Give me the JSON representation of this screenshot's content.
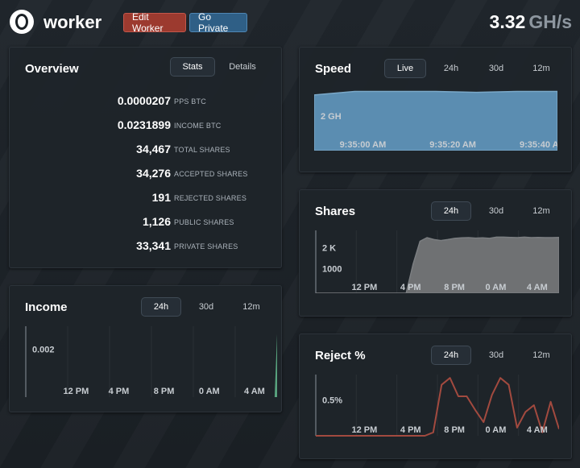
{
  "header": {
    "worker_name": "worker",
    "edit_label": "Edit Worker",
    "private_label": "Go Private",
    "hashrate_value": "3.32",
    "hashrate_unit": "GH/s"
  },
  "overview": {
    "title": "Overview",
    "tabs": [
      "Stats",
      "Details"
    ],
    "active_tab": "Stats",
    "rows": [
      {
        "value": "0.0000207",
        "label": "PPS BTC"
      },
      {
        "value": "0.0231899",
        "label": "INCOME BTC"
      },
      {
        "value": "34,467",
        "label": "TOTAL SHARES"
      },
      {
        "value": "34,276",
        "label": "ACCEPTED SHARES"
      },
      {
        "value": "191",
        "label": "REJECTED SHARES"
      },
      {
        "value": "1,126",
        "label": "PUBLIC SHARES"
      },
      {
        "value": "33,341",
        "label": "PRIVATE SHARES"
      }
    ]
  },
  "income": {
    "title": "Income",
    "tabs": [
      "24h",
      "30d",
      "12m"
    ],
    "active_tab": "24h"
  },
  "speed": {
    "title": "Speed",
    "tabs": [
      "Live",
      "24h",
      "30d",
      "12m"
    ],
    "active_tab": "Live"
  },
  "shares": {
    "title": "Shares",
    "tabs": [
      "24h",
      "30d",
      "12m"
    ],
    "active_tab": "24h"
  },
  "reject": {
    "title": "Reject %",
    "tabs": [
      "24h",
      "30d",
      "12m"
    ],
    "active_tab": "24h"
  },
  "colors": {
    "speed_fill": "#5b8db1",
    "shares_fill": "#6f7173",
    "income_fill": "#58a37e",
    "reject_line": "#a24a3f",
    "edit_button": "#9c3a2f",
    "private_button": "#2f5f86"
  },
  "chart_data": [
    {
      "id": "speed",
      "type": "area",
      "x": [
        "9:35:00 AM",
        "9:35:20 AM",
        "9:35:40 AM"
      ],
      "y_ticks": [
        "2 GH"
      ],
      "series": [
        {
          "values": [
            3.1,
            3.3,
            3.3,
            3.3,
            3.25,
            3.3,
            3.3
          ]
        }
      ],
      "ylim": [
        0,
        3.5
      ]
    },
    {
      "id": "shares",
      "type": "area",
      "x": [
        "12 PM",
        "4 PM",
        "8 PM",
        "0 AM",
        "4 AM"
      ],
      "y_ticks": [
        "2 K",
        "1000"
      ],
      "series": [
        {
          "values": [
            0,
            0,
            0,
            0,
            0,
            0,
            0,
            0,
            0,
            0,
            0,
            0,
            0,
            0,
            1200,
            2150,
            2300,
            2220,
            2180,
            2220,
            2270,
            2290,
            2300,
            2280,
            2290,
            2270,
            2320,
            2320,
            2310,
            2300,
            2320,
            2300,
            2310,
            2300,
            2300,
            2310
          ]
        }
      ],
      "ylim": [
        0,
        2600
      ]
    },
    {
      "id": "income",
      "type": "area",
      "x": [
        "12 PM",
        "4 PM",
        "8 PM",
        "0 AM",
        "4 AM"
      ],
      "y_ticks": [
        "0.002"
      ],
      "series": [
        {
          "values": [
            0,
            0,
            0,
            0,
            0,
            0,
            0.004
          ]
        }
      ],
      "ylim": [
        0,
        0.0045
      ]
    },
    {
      "id": "reject",
      "type": "line",
      "x": [
        "12 PM",
        "4 PM",
        "8 PM",
        "0 AM",
        "4 AM"
      ],
      "y_ticks": [
        "0.5%"
      ],
      "series": [
        {
          "values": [
            0,
            0,
            0,
            0,
            0,
            0,
            0,
            0,
            0,
            0,
            0,
            0,
            0,
            0,
            0.05,
            0.75,
            0.85,
            0.58,
            0.58,
            0.38,
            0.2,
            0.6,
            0.85,
            0.75,
            0.12,
            0.35,
            0.45,
            0.05,
            0.5,
            0.1
          ]
        }
      ],
      "ylim": [
        0,
        0.9
      ]
    }
  ]
}
